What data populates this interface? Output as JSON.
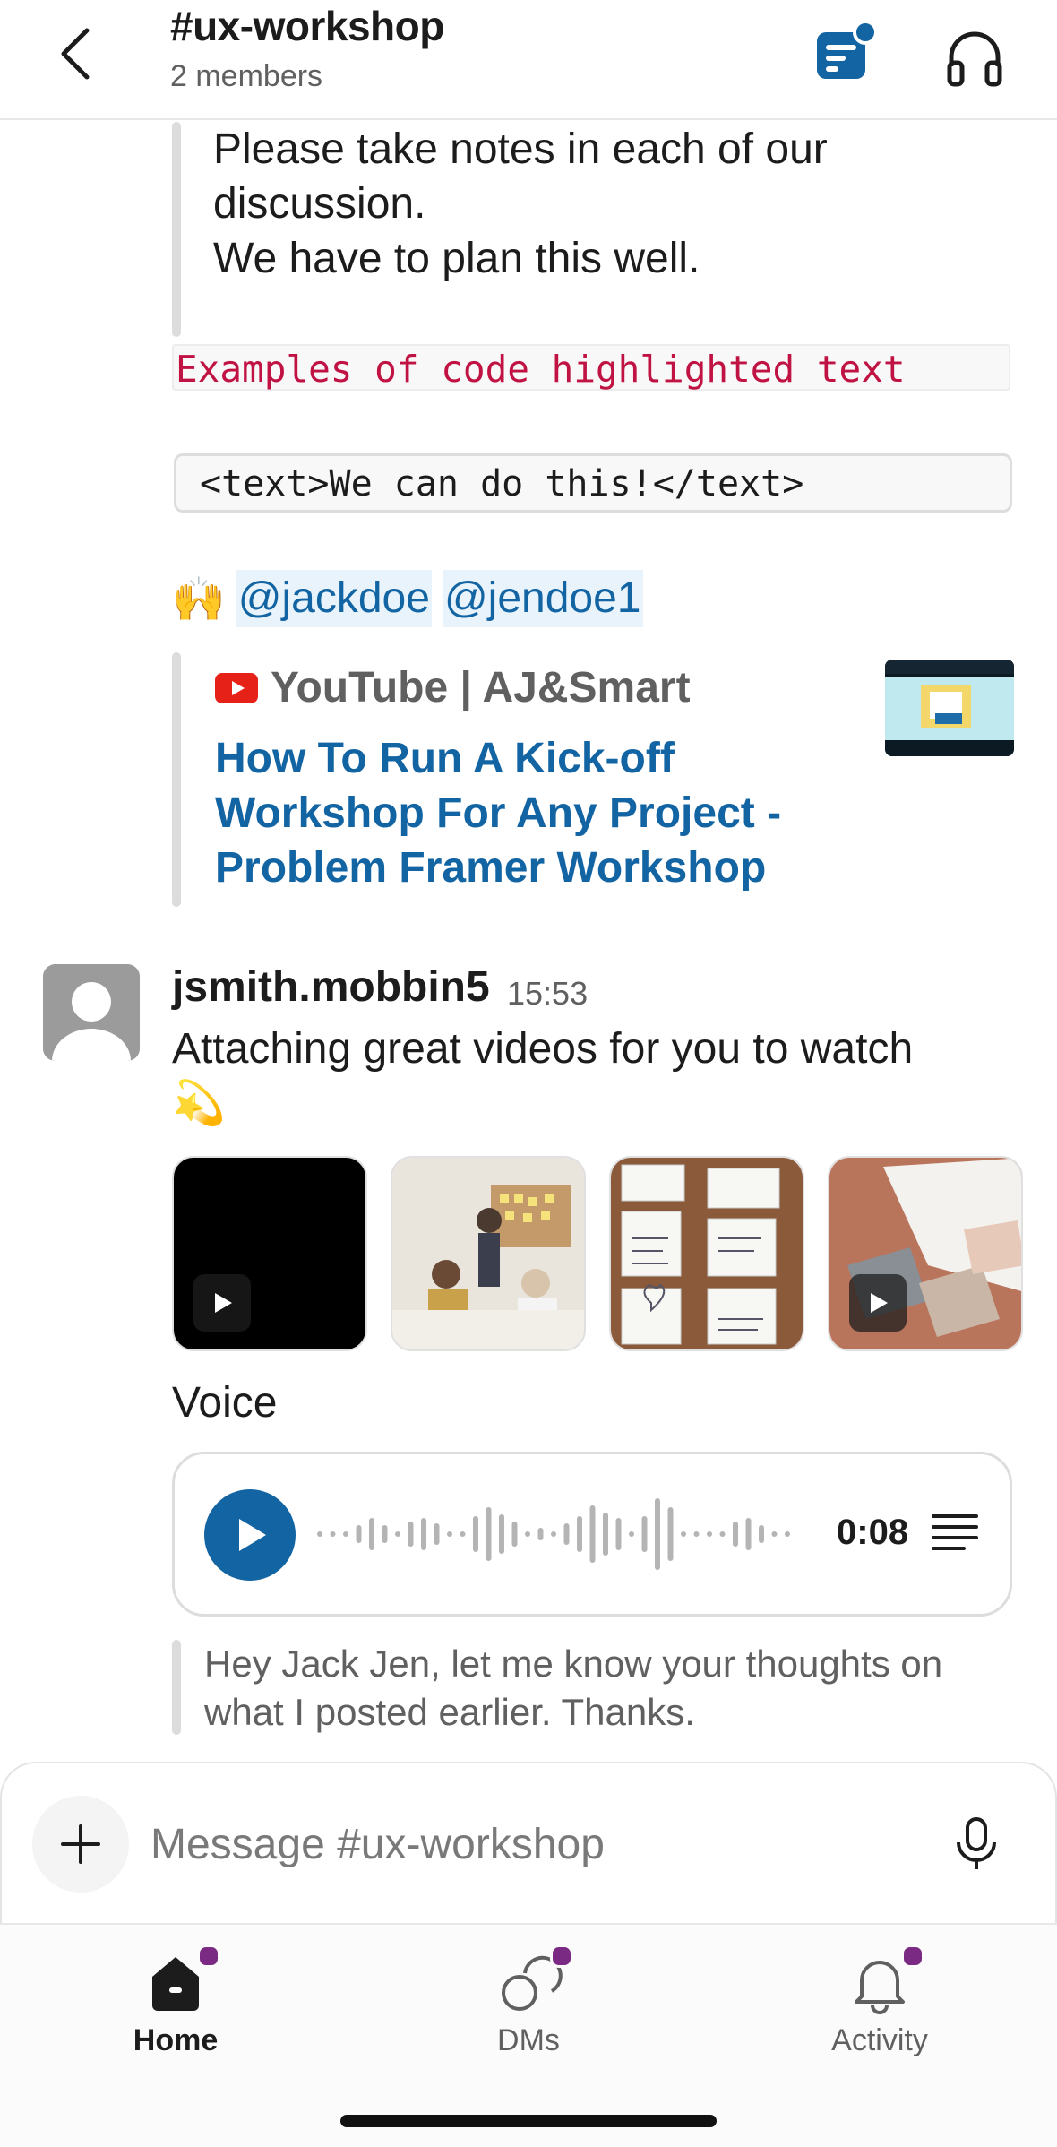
{
  "header": {
    "title": "#ux-workshop",
    "subtitle": "2 members",
    "back_icon": "chevron-left-icon",
    "canvas_icon": "canvas-icon",
    "huddle_icon": "headphones-icon"
  },
  "messages": {
    "quote_lines": [
      "Please take notes in each of our",
      "discussion.",
      "We have to plan this well."
    ],
    "inline_code": "Examples of code highlighted text",
    "code_block": "<text>We can do this!</text>",
    "emoji_hands": "🙌",
    "mentions": [
      "@jackdoe",
      "@jendoe1"
    ],
    "link_unfurl": {
      "source": "YouTube | AJ&Smart",
      "title": "How To Run A Kick-off Workshop For Any Project - Problem Framer Workshop"
    },
    "second": {
      "author": "jsmith.mobbin5",
      "time": "15:53",
      "text": "Attaching great videos for you to watch",
      "emoji": "💫",
      "voice_label": "Voice",
      "voice_duration": "0:08",
      "reply": "Hey Jack Jen, let me know your thoughts on what I posted earlier. Thanks."
    }
  },
  "composer": {
    "placeholder": "Message #ux-workshop",
    "attach_icon": "plus-icon",
    "mic_icon": "microphone-icon"
  },
  "tabs": [
    {
      "label": "Home",
      "icon": "home-icon",
      "active": true
    },
    {
      "label": "DMs",
      "icon": "dms-icon",
      "active": false
    },
    {
      "label": "Activity",
      "icon": "bell-icon",
      "active": false
    }
  ],
  "colors": {
    "link": "#1264a3",
    "code_text": "#c01343",
    "badge": "#7b2a84",
    "mention_bg": "#e8f3fb"
  }
}
